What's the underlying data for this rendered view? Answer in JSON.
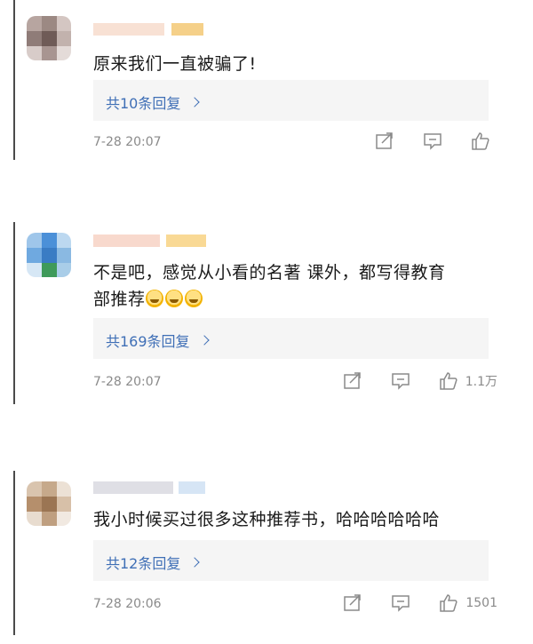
{
  "comments": [
    {
      "text_lines": [
        "原来我们一直被骗了!"
      ],
      "reply_label": "共10条回复",
      "time": "7-28 20:07",
      "like_count": ""
    },
    {
      "text_lines": [
        "不是吧，感觉从小看的名著 课外，都写得教育",
        "部推荐"
      ],
      "emoji_count": 3,
      "reply_label": "共169条回复",
      "time": "7-28 20:07",
      "like_count": "1.1万"
    },
    {
      "text_lines": [
        "我小时候买过很多这种推荐书，哈哈哈哈哈哈"
      ],
      "reply_label": "共12条回复",
      "time": "7-28 20:06",
      "like_count": "1501"
    }
  ],
  "icons": {
    "share": "share-icon",
    "comment": "comment-icon",
    "like": "thumbs-up-icon",
    "reply_chevron": "chevron-right-icon"
  },
  "colors": {
    "link": "#3f6fb6",
    "meta": "#8a8a8a",
    "reply_bg": "#f5f5f5"
  }
}
